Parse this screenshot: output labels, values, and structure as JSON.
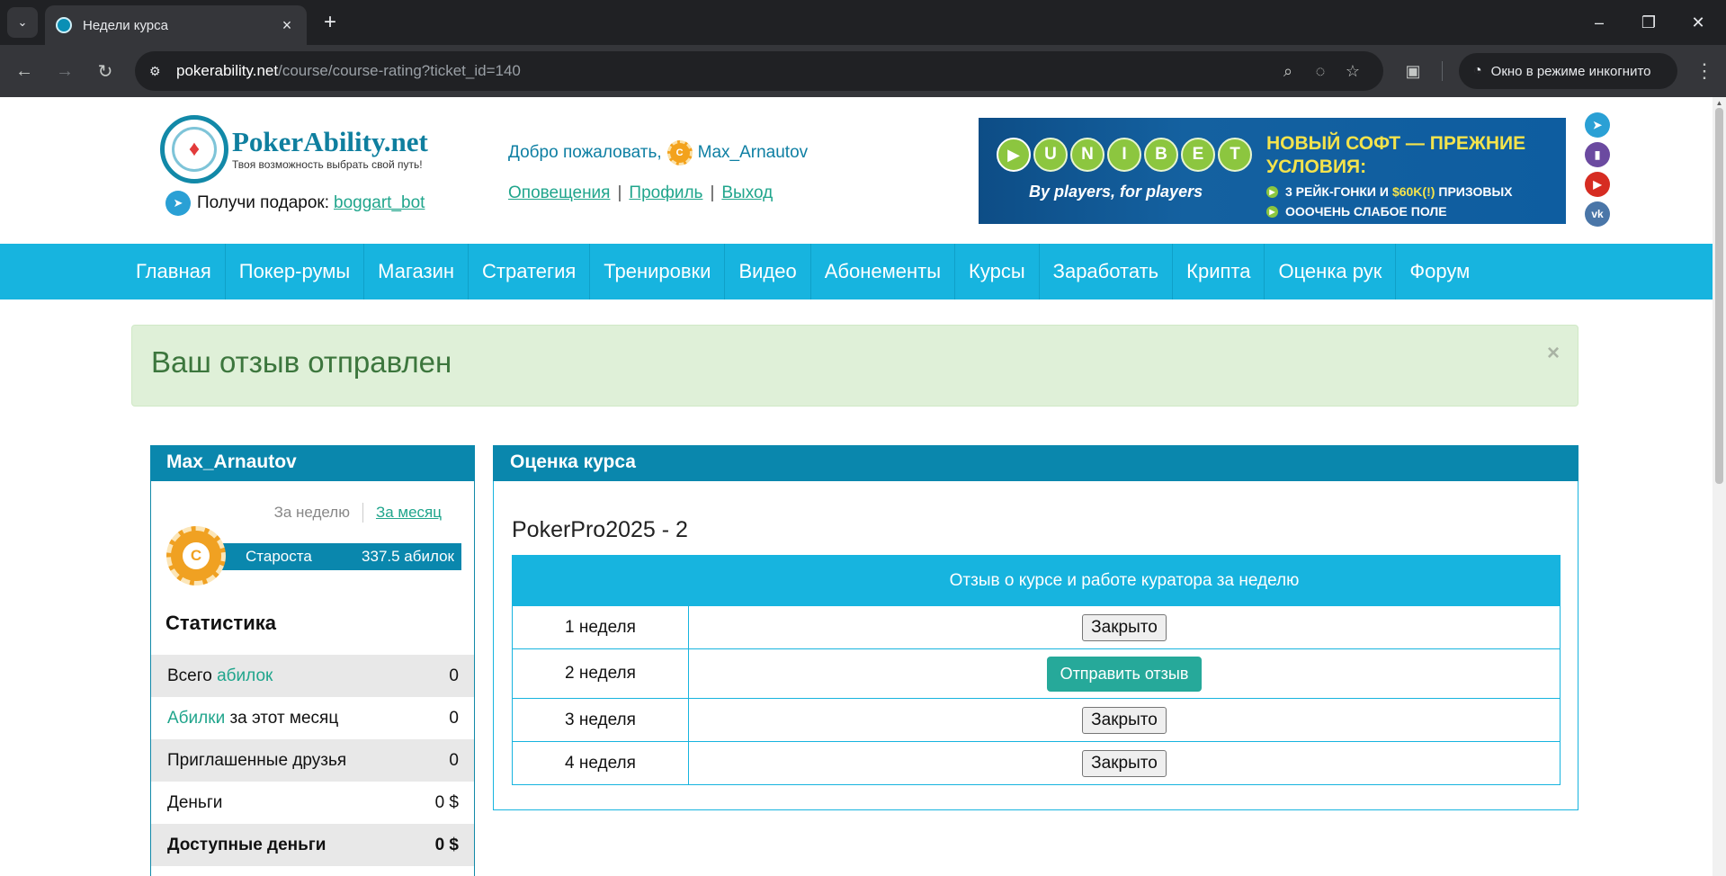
{
  "browser": {
    "tab_title": "Недели курса",
    "url_host": "pokerability.net",
    "url_path": "/course/course-rating?ticket_id=140",
    "incognito_label": "Окно в режиме инкогнито"
  },
  "header": {
    "logo_name": "PokerAbility.net",
    "logo_tagline": "Твоя возможность выбрать свой путь!",
    "gift_label": "Получи подарок:",
    "gift_link": "boggart_bot",
    "welcome_label": "Добро пожаловать,",
    "username": "Max_Arnautov",
    "links": [
      "Оповещения",
      "Профиль",
      "Выход"
    ]
  },
  "banner": {
    "brand_letters": [
      "U",
      "N",
      "I",
      "B",
      "E",
      "T"
    ],
    "tagline": "By players, for players",
    "headline": "НОВЫЙ СОФТ — ПРЕЖНИЕ УСЛОВИЯ:",
    "line1_pre": "3 РЕЙК-ГОНКИ И",
    "line1_hl": "$60K(!)",
    "line1_post": "ПРИЗОВЫХ",
    "line2": "ОООЧЕНЬ СЛАБОЕ ПОЛЕ"
  },
  "nav": [
    "Главная",
    "Покер-румы",
    "Магазин",
    "Стратегия",
    "Тренировки",
    "Видео",
    "Абонементы",
    "Курсы",
    "Заработать",
    "Крипта",
    "Оценка рук",
    "Форум"
  ],
  "alert": {
    "message": "Ваш отзыв отправлен",
    "close": "×"
  },
  "profile": {
    "title": "Max_Arnautov",
    "period_week": "За неделю",
    "period_month": "За месяц",
    "rank_name": "Староста",
    "rank_points": "337.5 абилок",
    "coin_letter": "C",
    "stats_title": "Статистика",
    "stats": [
      {
        "label_pre": "Всего",
        "label_accent": "абилок",
        "label_post": "",
        "value": "0"
      },
      {
        "label_pre": "",
        "label_accent": "Абилки",
        "label_post": "за этот месяц",
        "value": "0"
      },
      {
        "label_pre": "Приглашенные друзья",
        "label_accent": "",
        "label_post": "",
        "value": "0"
      },
      {
        "label_pre": "Деньги",
        "label_accent": "",
        "label_post": "",
        "value": "0 $"
      },
      {
        "label_pre": "Доступные деньги",
        "label_accent": "",
        "label_post": "",
        "value": "0 $"
      }
    ]
  },
  "course": {
    "panel_title": "Оценка курса",
    "name": "PokerPro2025 - 2",
    "col_week": "",
    "col_review": "Отзыв о курсе и работе куратора за неделю",
    "closed_label": "Закрыто",
    "send_label": "Отправить отзыв",
    "weeks": [
      "1 неделя",
      "2 неделя",
      "3 неделя",
      "4 неделя"
    ]
  }
}
